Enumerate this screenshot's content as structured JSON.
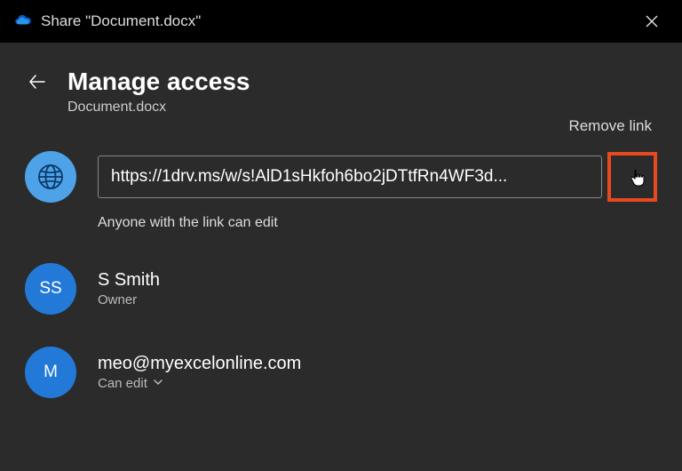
{
  "titlebar": {
    "text": "Share \"Document.docx\""
  },
  "page": {
    "title": "Manage access",
    "docName": "Document.docx",
    "removeLinkLabel": "Remove link"
  },
  "link": {
    "url": "https://1drv.ms/w/s!AlD1sHkfoh6bo2jDTtfRn4WF3d...",
    "description": "Anyone with the link can edit"
  },
  "people": [
    {
      "initials": "SS",
      "name": "S Smith",
      "role": "Owner",
      "hasDropdown": false
    },
    {
      "initials": "M",
      "name": "meo@myexcelonline.com",
      "role": "Can edit",
      "hasDropdown": true
    }
  ]
}
